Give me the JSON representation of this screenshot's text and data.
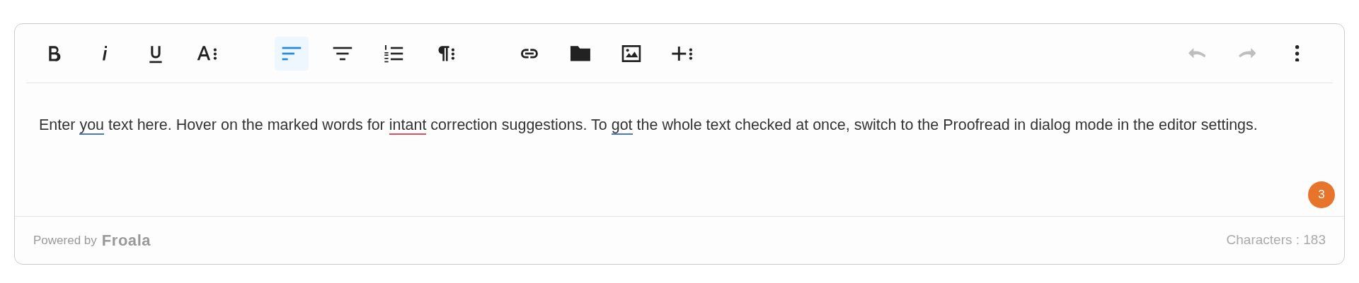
{
  "toolbar": {
    "format_buttons": [
      {
        "selected": false
      },
      {
        "selected": false
      },
      {
        "selected": false
      },
      {
        "selected": false
      }
    ],
    "paragraph_buttons": [
      {
        "selected": true
      },
      {
        "selected": false
      },
      {
        "selected": false
      },
      {
        "selected": false
      }
    ],
    "insert_buttons": [
      {
        "selected": false
      },
      {
        "selected": false
      },
      {
        "selected": false
      },
      {
        "selected": false
      }
    ],
    "history_buttons": [
      {
        "disabled": true
      },
      {
        "disabled": true
      }
    ]
  },
  "body": [
    {
      "kind": "text",
      "text": "Enter "
    },
    {
      "kind": "marked",
      "text": "you",
      "color": "#4a78c8"
    },
    {
      "kind": "text",
      "text": " text here. Hover on the marked words for "
    },
    {
      "kind": "marked",
      "text": "intant",
      "color": "#e0505a"
    },
    {
      "kind": "text",
      "text": " correction suggestions. To "
    },
    {
      "kind": "marked",
      "text": "got",
      "color": "#4a78c8"
    },
    {
      "kind": "text",
      "text": " the whole text checked at once, switch to the Proofread in dialog mode in the editor settings."
    }
  ],
  "issue_badge": "3",
  "footer": {
    "powered_by": "Powered by",
    "brand": "Froala",
    "counter": "Characters : 183"
  }
}
